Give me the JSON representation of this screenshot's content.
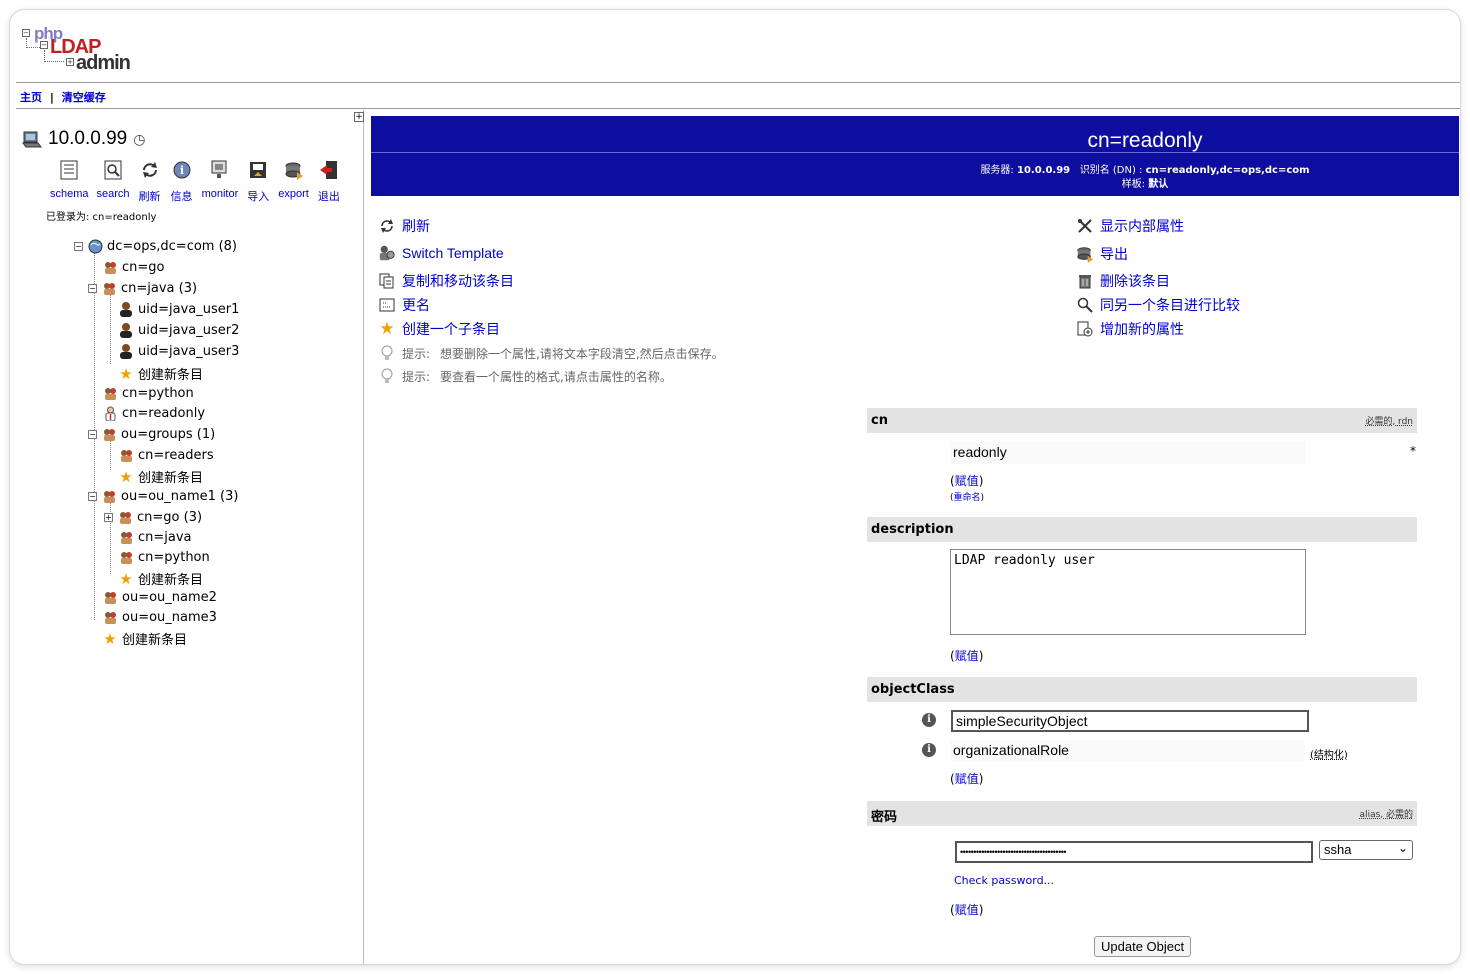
{
  "logo": {
    "php": "php",
    "ldap": "LDAP",
    "admin": "admin"
  },
  "topnav": {
    "home": "主页",
    "sep": "|",
    "purge": "清空缓存"
  },
  "server": {
    "name": "10.0.0.99",
    "logged_in": "已登录为: cn=readonly"
  },
  "toolbar": [
    {
      "label": "schema",
      "icon": "schema-icon"
    },
    {
      "label": "search",
      "icon": "search-icon"
    },
    {
      "label": "刷新",
      "icon": "refresh-icon"
    },
    {
      "label": "信息",
      "icon": "info-icon"
    },
    {
      "label": "monitor",
      "icon": "monitor-icon"
    },
    {
      "label": "导入",
      "icon": "import-icon"
    },
    {
      "label": "export",
      "icon": "export-icon"
    },
    {
      "label": "退出",
      "icon": "logout-icon"
    }
  ],
  "tree": [
    {
      "label": "dc=ops,dc=com (8)",
      "level": 0,
      "icon": "globe-icon",
      "toggle": "⊟"
    },
    {
      "label": "cn=go",
      "level": 1,
      "icon": "group-icon"
    },
    {
      "label": "cn=java (3)",
      "level": 1,
      "icon": "group-icon",
      "toggle": "⊟"
    },
    {
      "label": "uid=java_user1",
      "level": 2,
      "icon": "user-icon"
    },
    {
      "label": "uid=java_user2",
      "level": 2,
      "icon": "user-icon"
    },
    {
      "label": "uid=java_user3",
      "level": 2,
      "icon": "user-icon"
    },
    {
      "label": "创建新条目",
      "level": 2,
      "icon": "star-icon"
    },
    {
      "label": "cn=python",
      "level": 1,
      "icon": "group-icon"
    },
    {
      "label": "cn=readonly",
      "level": 1,
      "icon": "person-icon"
    },
    {
      "label": "ou=groups (1)",
      "level": 1,
      "icon": "group-icon",
      "toggle": "⊟"
    },
    {
      "label": "cn=readers",
      "level": 2,
      "icon": "group-icon"
    },
    {
      "label": "创建新条目",
      "level": 2,
      "icon": "star-icon"
    },
    {
      "label": "ou=ou_name1 (3)",
      "level": 1,
      "icon": "group-icon",
      "toggle": "⊟"
    },
    {
      "label": "cn=go (3)",
      "level": 2,
      "icon": "group-icon",
      "toggle": "⊞"
    },
    {
      "label": "cn=java",
      "level": 2,
      "icon": "group-icon"
    },
    {
      "label": "cn=python",
      "level": 2,
      "icon": "group-icon"
    },
    {
      "label": "创建新条目",
      "level": 2,
      "icon": "star-icon"
    },
    {
      "label": "ou=ou_name2",
      "level": 1,
      "icon": "group-icon"
    },
    {
      "label": "ou=ou_name3",
      "level": 1,
      "icon": "group-icon"
    },
    {
      "label": "创建新条目",
      "level": 1,
      "icon": "star-icon"
    }
  ],
  "banner": {
    "title": "cn=readonly",
    "meta_line1_a": "服务器:",
    "meta_line1_b": "10.0.0.99",
    "meta_line1_c": "识别名 (DN) :",
    "meta_line1_d": "cn=readonly,dc=ops,dc=com",
    "meta_line2_a": "样板:",
    "meta_line2_b": "默认"
  },
  "actions_left": [
    {
      "label": "刷新",
      "icon": "refresh-icon"
    },
    {
      "label": "Switch Template",
      "icon": "switch-template-icon"
    },
    {
      "label": "复制和移动该条目",
      "icon": "copy-icon"
    },
    {
      "label": "更名",
      "icon": "rename-icon"
    },
    {
      "label": "创建一个子条目",
      "icon": "star-icon"
    }
  ],
  "hints": [
    {
      "prefix": "提示:",
      "text": "想要删除一个属性,请将文本字段清空,然后点击保存。"
    },
    {
      "prefix": "提示:",
      "text": "要查看一个属性的格式,请点击属性的名称。"
    }
  ],
  "actions_right": [
    {
      "label": "显示内部属性",
      "icon": "tools-icon"
    },
    {
      "label": "导出",
      "icon": "export-icon"
    },
    {
      "label": "删除该条目",
      "icon": "trash-icon"
    },
    {
      "label": "同另一个条目进行比较",
      "icon": "compare-icon"
    },
    {
      "label": "增加新的属性",
      "icon": "add-attribute-icon"
    }
  ],
  "attributes": {
    "cn": {
      "name": "cn",
      "note": "必需的, rdn",
      "value": "readonly",
      "star": "*",
      "assign": "赋值",
      "rename": "重命名"
    },
    "description": {
      "name": "description",
      "value": "LDAP readonly user",
      "assign": "赋值"
    },
    "objectClass": {
      "name": "objectClass",
      "values": [
        "simpleSecurityObject",
        "organizationalRole"
      ],
      "structural": "(结构化)",
      "assign": "赋值"
    },
    "password": {
      "name": "密码",
      "note": "alias, 必需的",
      "value": "••••••••••••••••••••••••••••••••••••••••",
      "hash": "ssha",
      "check": "Check password...",
      "assign": "赋值"
    }
  },
  "update_button": "Update Object"
}
